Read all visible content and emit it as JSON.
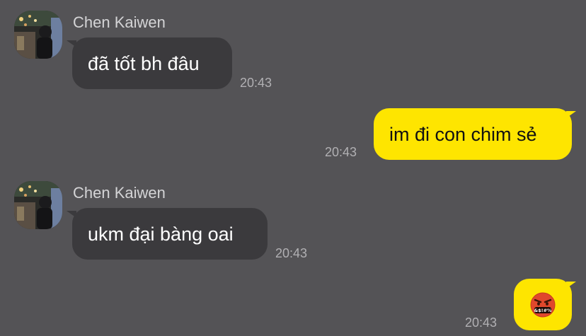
{
  "messages": [
    {
      "type": "incoming",
      "sender": "Chen Kaiwen",
      "text": "đã tốt bh đâu",
      "time": "20:43",
      "avatar_icon": "profile-photo"
    },
    {
      "type": "outgoing",
      "text": "im đi con chim sẻ",
      "time": "20:43"
    },
    {
      "type": "incoming",
      "sender": "Chen Kaiwen",
      "text": "ukm đại bàng oai",
      "time": "20:43",
      "avatar_icon": "profile-photo"
    },
    {
      "type": "outgoing",
      "emoji": "face-with-symbols-on-mouth",
      "emoji_text": "&$!#%",
      "time": "20:43"
    }
  ],
  "colors": {
    "background": "#545356",
    "incoming_bubble": "#3b3a3d",
    "outgoing_bubble": "#fee500",
    "sender_text": "#d4d4d6",
    "time_text": "#b1b0b3"
  }
}
